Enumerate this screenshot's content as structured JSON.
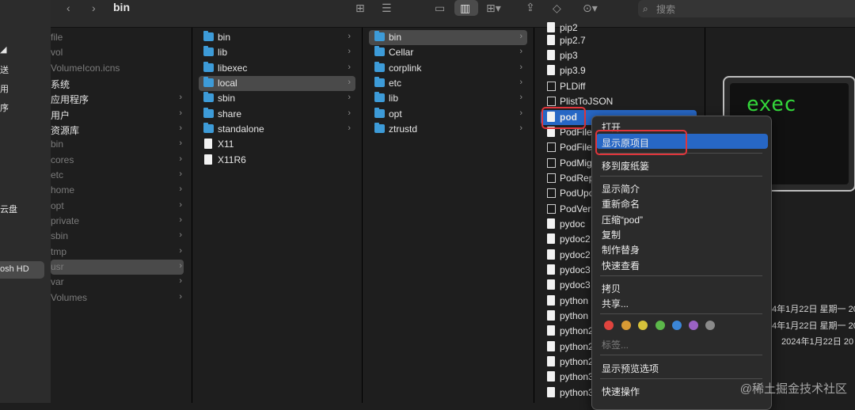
{
  "toolbar": {
    "title": "bin",
    "search_placeholder": "搜索"
  },
  "sidebar": {
    "items": [
      "",
      "送",
      "用",
      "序",
      "云盘",
      "osh HD"
    ]
  },
  "col1": {
    "items": [
      "file",
      "vol",
      "VolumeIcon.icns",
      "系统",
      "应用程序",
      "用户",
      "资源库",
      "bin",
      "cores",
      "etc",
      "home",
      "opt",
      "private",
      "sbin",
      "tmp",
      "usr",
      "var",
      "Volumes"
    ]
  },
  "col2": {
    "items": [
      "bin",
      "lib",
      "libexec",
      "local",
      "sbin",
      "share",
      "standalone",
      "X11",
      "X11R6"
    ]
  },
  "col3": {
    "items": [
      "bin",
      "Cellar",
      "corplink",
      "etc",
      "lib",
      "opt",
      "ztrustd"
    ]
  },
  "col4": {
    "items": [
      "pip2",
      "pip2.7",
      "pip3",
      "pip3.9",
      "PLDiff",
      "PlistToJSON",
      "pod",
      "PodFile",
      "PodFile",
      "PodMig",
      "PodRep",
      "PodUpo",
      "PodVer",
      "pydoc",
      "pydoc2",
      "pydoc2",
      "pydoc3",
      "pydoc3",
      "python",
      "python",
      "python2",
      "python2",
      "python2",
      "python3",
      "python3"
    ]
  },
  "preview": {
    "icon_text": "exec",
    "dates": [
      "4年1月22日 星期一 20",
      "4年1月22日 星期一 20",
      "2024年1月22日 20"
    ]
  },
  "context_menu": {
    "open": "打开",
    "show_original": "显示原项目",
    "move_to_trash": "移到废纸篓",
    "get_info": "显示简介",
    "rename": "重新命名",
    "compress": "压缩“pod”",
    "duplicate": "复制",
    "make_alias": "制作替身",
    "quick_look": "快速查看",
    "copy": "拷贝",
    "share": "共享...",
    "tags": "标签...",
    "show_preview_options": "显示预览选项",
    "quick_actions": "快速操作"
  },
  "tag_colors": [
    "#e0443e",
    "#d89a34",
    "#d6c23a",
    "#5cb84a",
    "#3b86d8",
    "#9a62c4",
    "#8a8a8a"
  ],
  "watermark": "@稀土掘金技术社区"
}
